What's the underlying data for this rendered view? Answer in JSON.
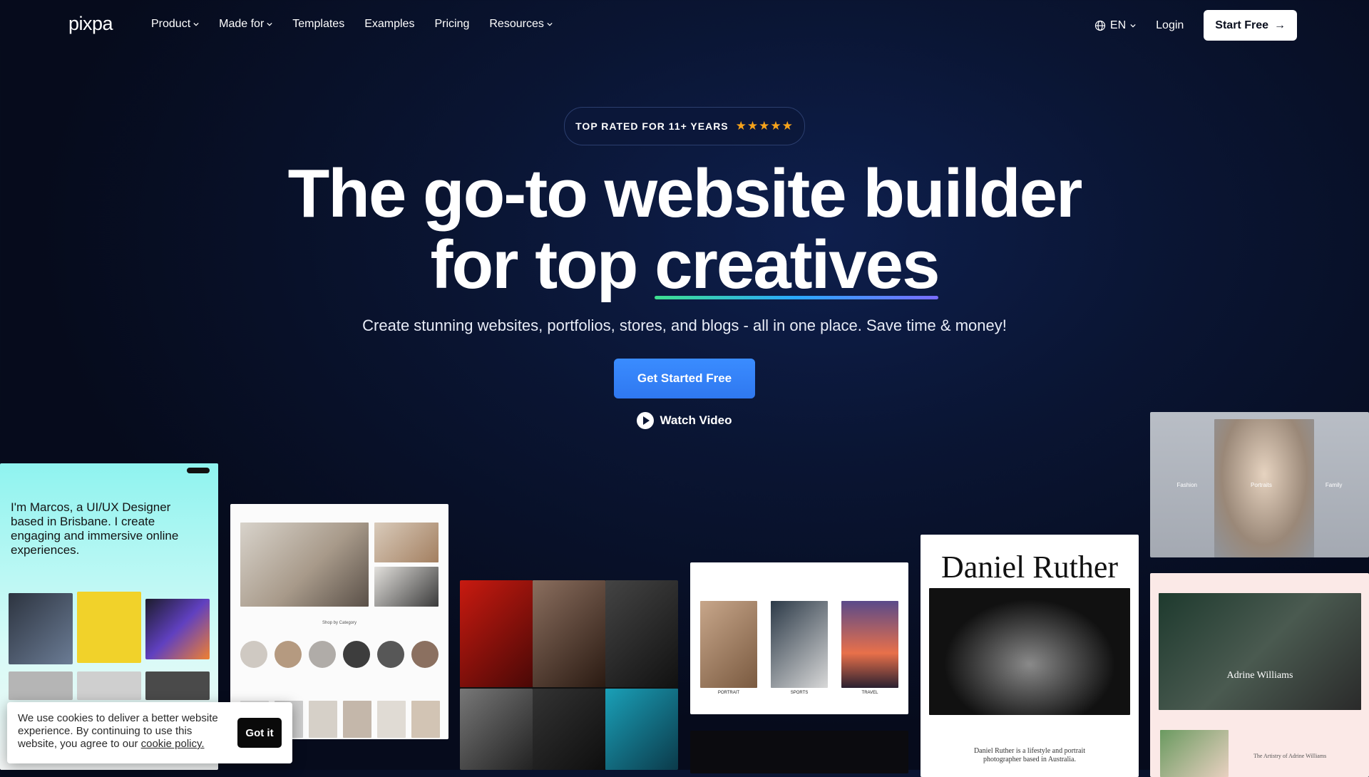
{
  "brand": {
    "logo": "pixpa"
  },
  "nav": {
    "items": [
      {
        "label": "Product",
        "has_dropdown": true
      },
      {
        "label": "Made for",
        "has_dropdown": true
      },
      {
        "label": "Templates",
        "has_dropdown": false
      },
      {
        "label": "Examples",
        "has_dropdown": false
      },
      {
        "label": "Pricing",
        "has_dropdown": false
      },
      {
        "label": "Resources",
        "has_dropdown": true
      }
    ],
    "language": "EN",
    "login": "Login",
    "start_free": "Start Free"
  },
  "hero": {
    "badge": "TOP RATED FOR 11+ YEARS",
    "rating_stars": 5,
    "headline_line1": "The go-to website builder",
    "headline_line2_prefix": "for top ",
    "headline_line2_highlight": "creatives",
    "subheadline": "Create stunning websites, portfolios, stores, and blogs - all in one place. Save time & money!",
    "cta_primary": "Get Started Free",
    "cta_secondary": "Watch Video"
  },
  "showcase": {
    "marcos_intro": "I'm Marcos, a UI/UX Designer based in Brisbane. I create engaging and immersive online experiences.",
    "ruther_name": "Daniel Ruther",
    "ruther_caption": "Daniel Ruther is a lifestyle and portrait photographer based in Australia.",
    "adrine_name": "Adrine Williams",
    "adrine_sub": "The Artistry of Adrine Williams",
    "shop_heading": "Shop by Category",
    "portfolio_labels": [
      "PORTRAIT",
      "SPORTS",
      "TRAVEL"
    ],
    "fashion_tabs": [
      "Fashion",
      "Portraits",
      "Family"
    ]
  },
  "cookie": {
    "text": "We use cookies to deliver a better website experience. By continuing to use this website, you agree to our ",
    "link": "cookie policy.",
    "button": "Got it"
  },
  "colors": {
    "background": "#0a1533",
    "cta": "#3a8cff",
    "star": "#f6a31b",
    "underline_gradient": [
      "#3ee08f",
      "#2aa8ff",
      "#7a6cff"
    ]
  }
}
